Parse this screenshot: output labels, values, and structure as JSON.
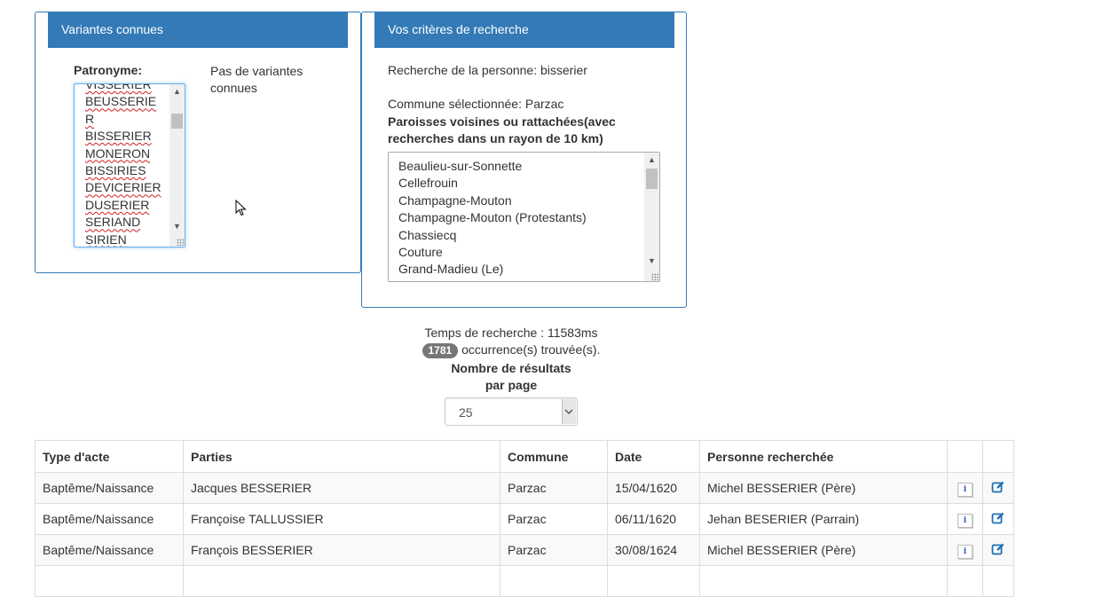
{
  "variants_panel": {
    "title": "Variantes connues",
    "patronyme_label": "Patronyme:",
    "variants_list": [
      "VISSERIER",
      "BEUSSERIE",
      "R",
      "BISSERIER",
      "MONERON",
      "BISSIRIES",
      "DEVICERIER",
      "DUSERIER",
      "SERIAND",
      "SIRIEN"
    ],
    "no_variants_line1": "Pas de variantes",
    "no_variants_line2": "connues"
  },
  "criteria_panel": {
    "title": "Vos critères de recherche",
    "person_search": "Recherche de la personne: bisserier",
    "commune_selected": "Commune sélectionnée: Parzac",
    "parishes_heading_line1": "Paroisses voisines ou rattachées(avec",
    "parishes_heading_line2": "recherches dans un rayon de 10 km)",
    "parishes": [
      "Beaulieu-sur-Sonnette",
      "Cellefrouin",
      "Champagne-Mouton",
      "Champagne-Mouton (Protestants)",
      "Chassiecq",
      "Couture",
      "Grand-Madieu (Le)"
    ]
  },
  "summary": {
    "search_time": "Temps de recherche : 11583ms",
    "count_badge": "1781",
    "occurrences_text": "occurrence(s) trouvée(s).",
    "per_page_label_line1": "Nombre de résultats",
    "per_page_label_line2": "par page",
    "per_page_value": "25"
  },
  "table": {
    "headers": [
      "Type d'acte",
      "Parties",
      "Commune",
      "Date",
      "Personne recherchée",
      "",
      ""
    ],
    "rows": [
      {
        "type": "Baptême/Naissance",
        "parties": "Jacques BESSERIER",
        "commune": "Parzac",
        "date": "15/04/1620",
        "person": "Michel BESSERIER (Père)"
      },
      {
        "type": "Baptême/Naissance",
        "parties": "Françoise TALLUSSIER",
        "commune": "Parzac",
        "date": "06/11/1620",
        "person": "Jehan BESERIER (Parrain)"
      },
      {
        "type": "Baptême/Naissance",
        "parties": "François BESSERIER",
        "commune": "Parzac",
        "date": "30/08/1624",
        "person": "Michel BESSERIER (Père)"
      }
    ]
  },
  "icons": {
    "info": "info-icon",
    "edit": "edit-icon"
  },
  "colors": {
    "panel_header": "#337ab7",
    "badge": "#777777",
    "edit_icon": "#1f6fb5"
  }
}
